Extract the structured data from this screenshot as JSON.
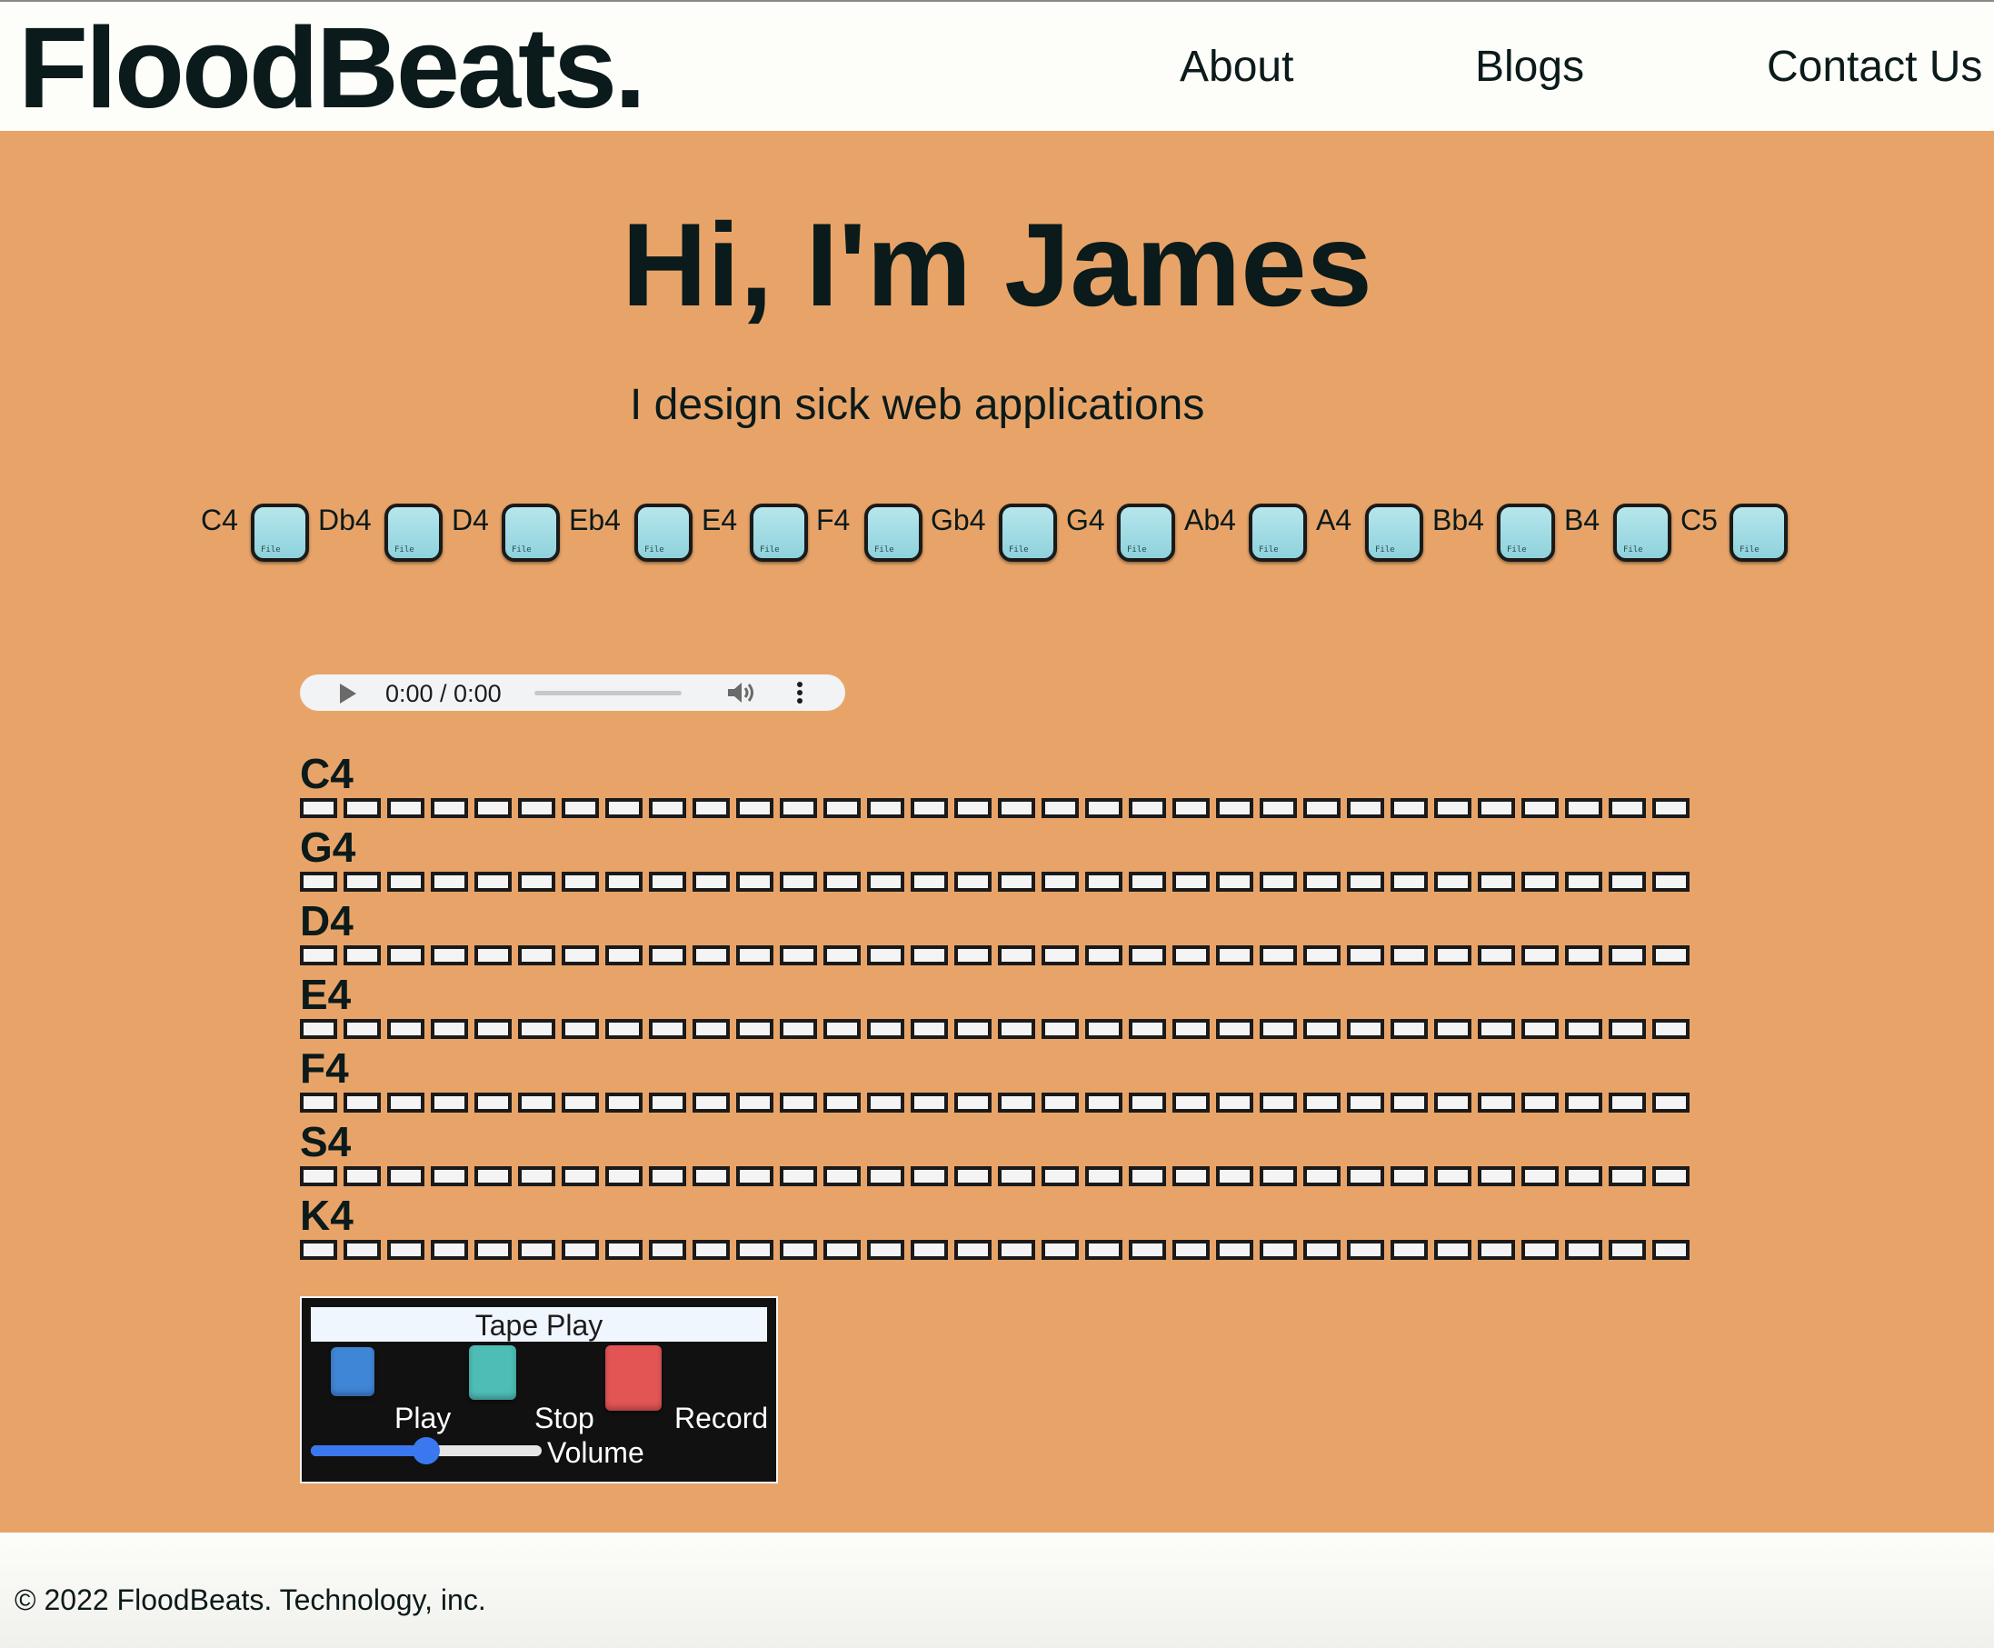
{
  "header": {
    "logo": "FloodBeats.",
    "nav": [
      {
        "label": "About"
      },
      {
        "label": "Blogs"
      },
      {
        "label": "Contact Us"
      }
    ]
  },
  "hero": {
    "title": "Hi, I'm James",
    "subtitle": "I design sick web applications"
  },
  "keys": [
    {
      "note": "C4",
      "file_label": "File"
    },
    {
      "note": "Db4",
      "file_label": "File"
    },
    {
      "note": "D4",
      "file_label": "File"
    },
    {
      "note": "Eb4",
      "file_label": "File"
    },
    {
      "note": "E4",
      "file_label": "File"
    },
    {
      "note": "F4",
      "file_label": "File"
    },
    {
      "note": "Gb4",
      "file_label": "File"
    },
    {
      "note": "G4",
      "file_label": "File"
    },
    {
      "note": "Ab4",
      "file_label": "File"
    },
    {
      "note": "A4",
      "file_label": "File"
    },
    {
      "note": "Bb4",
      "file_label": "File"
    },
    {
      "note": "B4",
      "file_label": "File"
    },
    {
      "note": "C5",
      "file_label": "File"
    }
  ],
  "audio_player": {
    "time": "0:00 / 0:00",
    "progress": 0
  },
  "sequencer": {
    "steps_per_track": 32,
    "tracks": [
      {
        "label": "C4"
      },
      {
        "label": "G4"
      },
      {
        "label": "D4"
      },
      {
        "label": "E4"
      },
      {
        "label": "F4"
      },
      {
        "label": "S4"
      },
      {
        "label": "K4"
      }
    ]
  },
  "tape": {
    "title": "Tape Play",
    "play_label": "Play",
    "stop_label": "Stop",
    "record_label": "Record",
    "volume_label": "Volume",
    "volume_level": 0.5,
    "colors": {
      "play": "#3f86d6",
      "stop": "#4dbdb5",
      "record": "#e35555",
      "slider": "#3a78f0"
    }
  },
  "footer": {
    "copyright": "© 2022 FloodBeats. Technology, inc."
  },
  "colors": {
    "main_background": "#e8a468",
    "header_background": "#fdfdf9",
    "text": "#0b1a1a",
    "key_button": "#a6dde4"
  }
}
